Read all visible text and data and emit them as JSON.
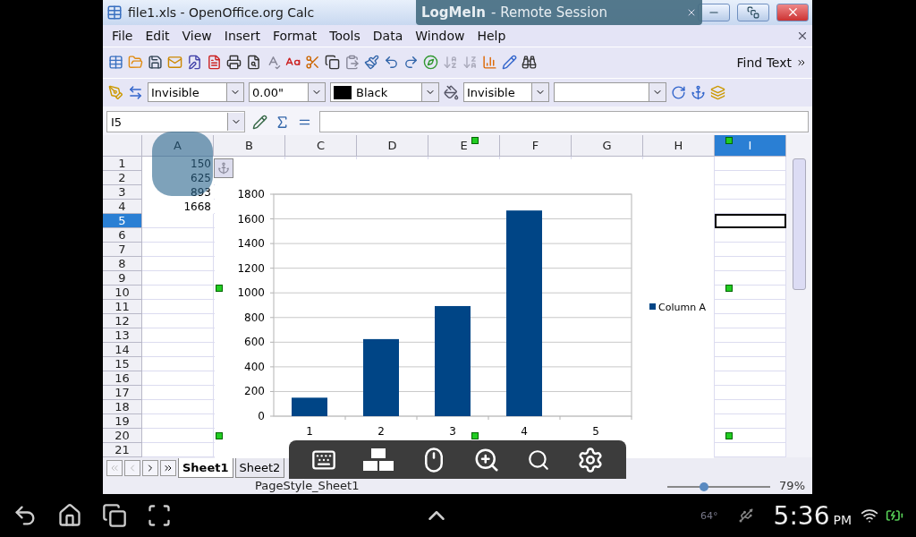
{
  "window": {
    "title": "file1.xls - OpenOffice.org Calc"
  },
  "remote_banner": {
    "brand": "LogMeIn",
    "subtitle": "- Remote Session"
  },
  "menu": [
    {
      "label": "File"
    },
    {
      "label": "Edit"
    },
    {
      "label": "View"
    },
    {
      "label": "Insert"
    },
    {
      "label": "Format"
    },
    {
      "label": "Tools"
    },
    {
      "label": "Data"
    },
    {
      "label": "Window"
    },
    {
      "label": "Help"
    }
  ],
  "find_toolbar": {
    "label": "Find Text"
  },
  "line_toolbar": {
    "line_style": "Invisible",
    "line_width": "0.00\"",
    "line_color": "Black",
    "area_style": "Invisible"
  },
  "formula_bar": {
    "name_box": "I5"
  },
  "sheet": {
    "columns": [
      {
        "label": "A",
        "selected": false
      },
      {
        "label": "B",
        "selected": false
      },
      {
        "label": "C",
        "selected": false
      },
      {
        "label": "D",
        "selected": false
      },
      {
        "label": "E",
        "selected": false
      },
      {
        "label": "F",
        "selected": false
      },
      {
        "label": "G",
        "selected": false
      },
      {
        "label": "H",
        "selected": false
      },
      {
        "label": "I",
        "selected": true
      }
    ],
    "rows": [
      {
        "label": "1",
        "selected": false,
        "value": "150"
      },
      {
        "label": "2",
        "selected": false,
        "value": "625"
      },
      {
        "label": "3",
        "selected": false,
        "value": "893"
      },
      {
        "label": "4",
        "selected": false,
        "value": "1668"
      },
      {
        "label": "5",
        "selected": true
      },
      {
        "label": "6",
        "selected": false
      },
      {
        "label": "7",
        "selected": false
      },
      {
        "label": "8",
        "selected": false
      },
      {
        "label": "9",
        "selected": false
      },
      {
        "label": "10",
        "selected": false
      },
      {
        "label": "11",
        "selected": false
      },
      {
        "label": "12",
        "selected": false
      },
      {
        "label": "13",
        "selected": false
      },
      {
        "label": "14",
        "selected": false
      },
      {
        "label": "15",
        "selected": false
      },
      {
        "label": "16",
        "selected": false
      },
      {
        "label": "17",
        "selected": false
      },
      {
        "label": "18",
        "selected": false
      },
      {
        "label": "19",
        "selected": false
      },
      {
        "label": "20",
        "selected": false
      },
      {
        "label": "21",
        "selected": false
      }
    ]
  },
  "chart": {
    "chart_data": {
      "type": "bar",
      "categories": [
        "1",
        "2",
        "3",
        "4",
        "5"
      ],
      "series": [
        {
          "name": "Column A",
          "color": "#004586",
          "values": [
            150,
            625,
            893,
            1668,
            null
          ]
        }
      ],
      "ylim": [
        0,
        1800
      ],
      "yticks": [
        0,
        200,
        400,
        600,
        800,
        1000,
        1200,
        1400,
        1600,
        1800
      ],
      "grid": true
    }
  },
  "sheet_tabs": [
    {
      "label": "Sheet1",
      "selected": true
    },
    {
      "label": "Sheet2",
      "selected": false
    }
  ],
  "status_bar": {
    "page_style": "PageStyle_Sheet1",
    "zoom": "79%",
    "zoom_slider": {
      "level": 0.36
    }
  },
  "android_bar": {
    "temperature": "64°",
    "time": "5:36",
    "ampm": "PM"
  }
}
